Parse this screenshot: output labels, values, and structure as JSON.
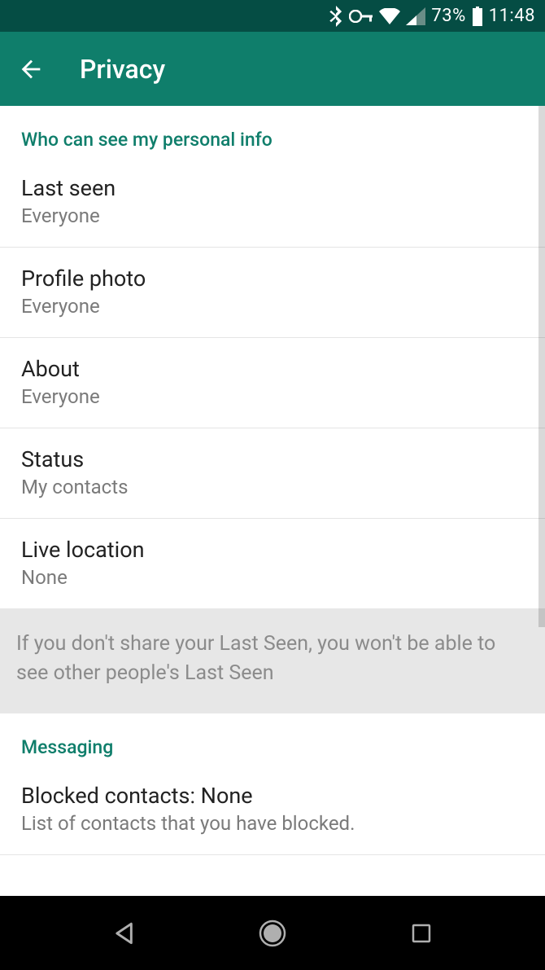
{
  "status_bar": {
    "battery_pct": "73%",
    "time": "11:48"
  },
  "header": {
    "title": "Privacy"
  },
  "sections": {
    "personal_info": {
      "header": "Who can see my personal info",
      "last_seen": {
        "title": "Last seen",
        "value": "Everyone"
      },
      "profile_photo": {
        "title": "Profile photo",
        "value": "Everyone"
      },
      "about": {
        "title": "About",
        "value": "Everyone"
      },
      "status": {
        "title": "Status",
        "value": "My contacts"
      },
      "live_location": {
        "title": "Live location",
        "value": "None"
      },
      "info_note": "If you don't share your Last Seen, you won't be able to see other people's Last Seen"
    },
    "messaging": {
      "header": "Messaging",
      "blocked": {
        "title": "Blocked contacts: None",
        "sub": "List of contacts that you have blocked."
      }
    }
  }
}
